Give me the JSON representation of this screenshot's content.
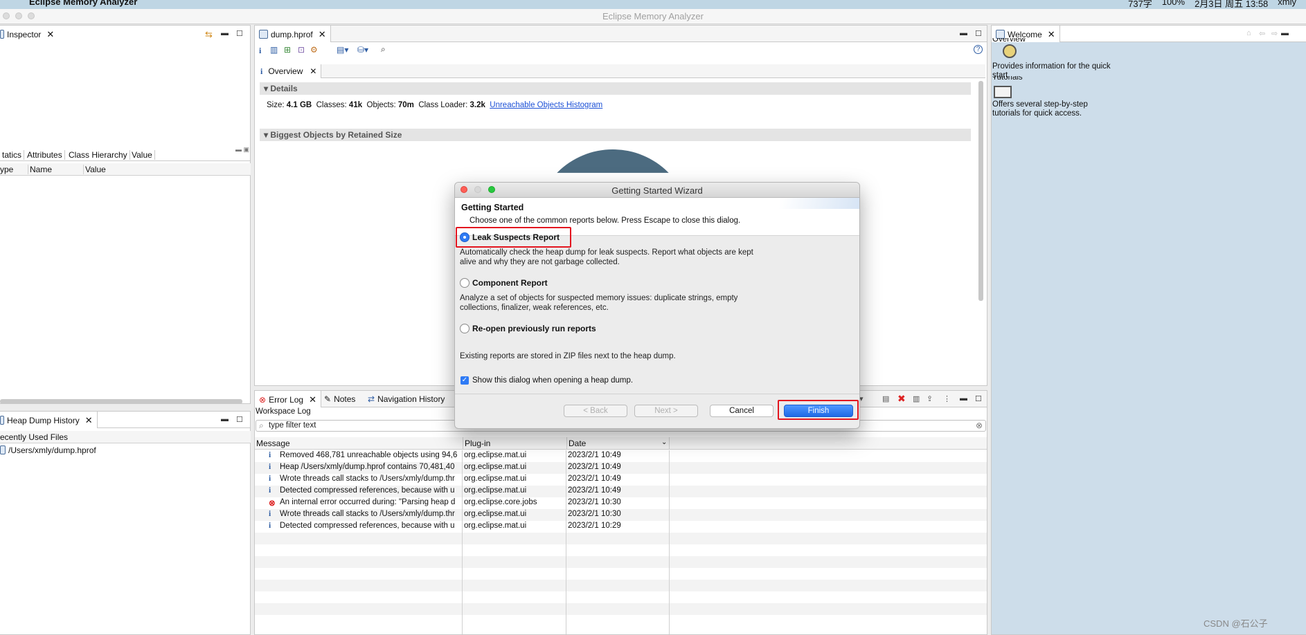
{
  "menubar": {
    "app_name": "Eclipse Memory Analyzer",
    "status_items": [
      "737字",
      "100%",
      "2月3日 周五 13:58",
      "xmly"
    ]
  },
  "window": {
    "title": "Eclipse Memory Analyzer"
  },
  "inspector": {
    "tab": "Inspector",
    "subtabs": [
      "tatics",
      "Attributes",
      "Class Hierarchy",
      "Value"
    ],
    "columns": [
      "ype",
      "Name",
      "Value"
    ]
  },
  "heap_history": {
    "tab": "Heap Dump History",
    "section": "ecently Used Files",
    "file": "/Users/xmly/dump.hprof"
  },
  "editor": {
    "tab": "dump.hprof",
    "overview_tab": "Overview",
    "details_header": "Details",
    "size_label": "Size:",
    "size_value": "4.1 GB",
    "classes_label": "Classes:",
    "classes_value": "41k",
    "objects_label": "Objects:",
    "objects_value": "70m",
    "loader_label": "Class Loader:",
    "loader_value": "3.2k",
    "unreachable_link": "Unreachable Objects Histogram",
    "biggest_header": "Biggest Objects by Retained Size"
  },
  "bottom": {
    "tabs": [
      "Error Log",
      "Notes",
      "Navigation History"
    ],
    "workspace_log": "Workspace Log",
    "filter_placeholder": "type filter text",
    "columns": [
      "Message",
      "Plug-in",
      "Date"
    ],
    "rows": [
      {
        "icon": "info",
        "message": "Removed 468,781 unreachable objects using 94,6",
        "plugin": "org.eclipse.mat.ui",
        "date": "2023/2/1 10:49"
      },
      {
        "icon": "info",
        "message": "Heap /Users/xmly/dump.hprof contains 70,481,40",
        "plugin": "org.eclipse.mat.ui",
        "date": "2023/2/1 10:49"
      },
      {
        "icon": "info",
        "message": "Wrote threads call stacks to /Users/xmly/dump.thr",
        "plugin": "org.eclipse.mat.ui",
        "date": "2023/2/1 10:49"
      },
      {
        "icon": "info",
        "message": "Detected compressed references, because with u",
        "plugin": "org.eclipse.mat.ui",
        "date": "2023/2/1 10:49"
      },
      {
        "icon": "error",
        "message": "An internal error occurred during: \"Parsing heap d",
        "plugin": "org.eclipse.core.jobs",
        "date": "2023/2/1 10:30"
      },
      {
        "icon": "info",
        "message": "Wrote threads call stacks to /Users/xmly/dump.thr",
        "plugin": "org.eclipse.mat.ui",
        "date": "2023/2/1 10:30"
      },
      {
        "icon": "info",
        "message": "Detected compressed references, because with u",
        "plugin": "org.eclipse.mat.ui",
        "date": "2023/2/1 10:29"
      }
    ]
  },
  "welcome": {
    "tab": "Welcome",
    "overview_title": "Overview",
    "overview_desc": "Provides information for the quick start.",
    "tutorials_title": "Tutorials",
    "tutorials_desc": "Offers several step-by-step tutorials for quick access."
  },
  "dialog": {
    "title": "Getting Started Wizard",
    "heading": "Getting Started",
    "subheading": "Choose one of the common reports below. Press Escape to close this dialog.",
    "options": [
      {
        "label": "Leak Suspects Report",
        "desc": "Automatically check the heap dump for leak suspects. Report what objects are kept alive and why they are not garbage collected.",
        "selected": true
      },
      {
        "label": "Component Report",
        "desc": "Analyze a set of objects for suspected memory issues: duplicate strings, empty collections, finalizer, weak references, etc.",
        "selected": false
      },
      {
        "label": "Re-open previously run reports",
        "desc": "Existing reports are stored in ZIP files next to the heap dump.",
        "selected": false
      }
    ],
    "checkbox_label": "Show this dialog when opening a heap dump.",
    "checkbox_checked": true,
    "back_label": "< Back",
    "next_label": "Next >",
    "cancel_label": "Cancel",
    "finish_label": "Finish"
  },
  "watermark": "CSDN @石公子",
  "colors": {
    "highlight": "#e3151f",
    "accent": "#2f7bf5",
    "welcome_bg": "#cdddea"
  }
}
